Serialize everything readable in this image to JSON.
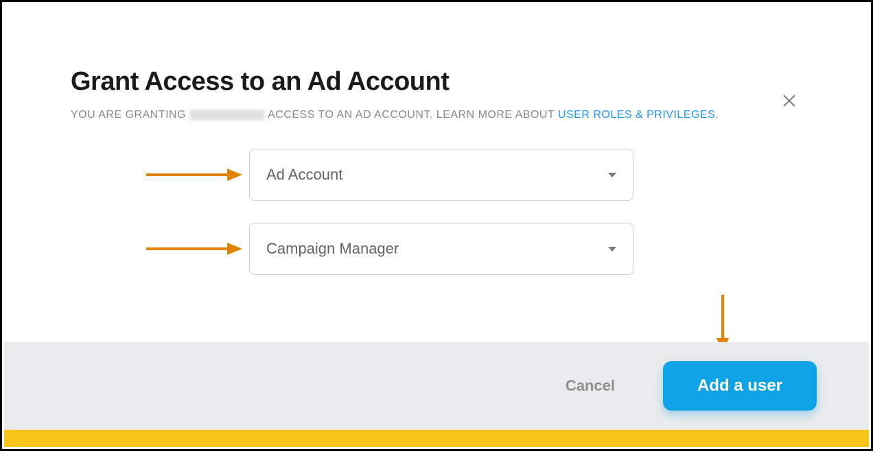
{
  "dialog": {
    "title": "Grant Access to an Ad Account",
    "subtitle_prefix": "YOU ARE GRANTING ",
    "subtitle_mid": " ACCESS TO AN AD ACCOUNT. LEARN MORE ABOUT ",
    "subtitle_link": "USER ROLES & PRIVILEGES",
    "subtitle_suffix": "."
  },
  "fields": {
    "account": {
      "label": "Ad Account"
    },
    "role": {
      "label": "Campaign Manager"
    }
  },
  "actions": {
    "cancel": "Cancel",
    "add": "Add a user"
  },
  "annotations": {
    "arrow_color": "#e08300"
  }
}
